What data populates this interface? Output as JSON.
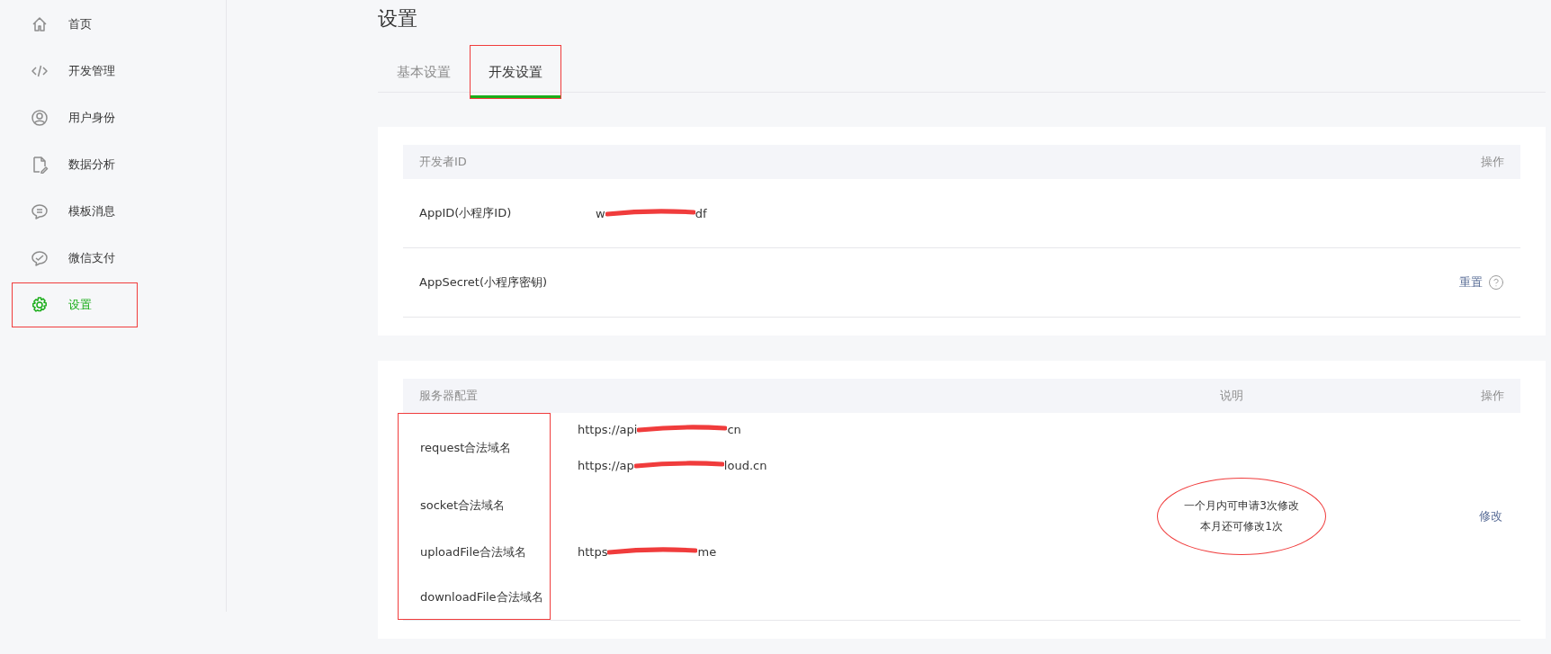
{
  "sidebar": {
    "items": [
      {
        "label": "首页",
        "selected": false,
        "annotated": false
      },
      {
        "label": "开发管理",
        "selected": false,
        "annotated": false
      },
      {
        "label": "用户身份",
        "selected": false,
        "annotated": false
      },
      {
        "label": "数据分析",
        "selected": false,
        "annotated": false
      },
      {
        "label": "模板消息",
        "selected": false,
        "annotated": false
      },
      {
        "label": "微信支付",
        "selected": false,
        "annotated": false
      },
      {
        "label": "设置",
        "selected": true,
        "annotated": true
      }
    ]
  },
  "page_title": "设置",
  "tabs": [
    {
      "label": "基本设置",
      "selected": false,
      "annotated": false
    },
    {
      "label": "开发设置",
      "selected": true,
      "annotated": true
    }
  ],
  "developer_id": {
    "columns": [
      "开发者ID",
      "操作"
    ],
    "rows": [
      {
        "label": "AppID(小程序ID)",
        "value": {
          "before": "w",
          "after": "df",
          "redacted": true
        }
      },
      {
        "label": "AppSecret(小程序密钥)",
        "action": "重置",
        "help": true
      }
    ]
  },
  "server_config": {
    "columns": [
      "服务器配置",
      "说明",
      "操作"
    ],
    "labels_annotated": true,
    "domains": [
      {
        "label": "request合法域名",
        "values": [
          {
            "before": "https://api",
            "after": "cn",
            "redacted": true
          },
          {
            "before": "https://ap",
            "after": "loud.cn",
            "redacted": true
          }
        ]
      },
      {
        "label": "socket合法域名"
      },
      {
        "label": "uploadFile合法域名",
        "values": [
          {
            "before": "https",
            "after": "me",
            "redacted": true
          }
        ]
      },
      {
        "label": "downloadFile合法域名"
      }
    ],
    "note": [
      "一个月内可申请3次修改",
      "本月还可修改1次"
    ],
    "note_annotated": true,
    "action": "修改"
  }
}
